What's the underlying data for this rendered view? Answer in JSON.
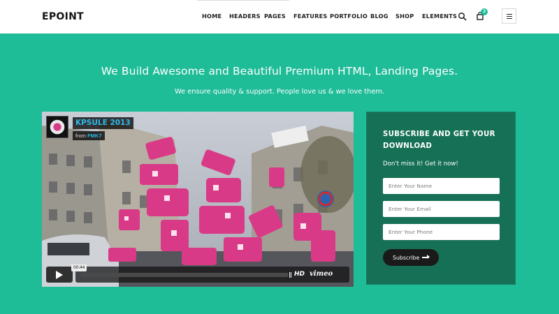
{
  "header": {
    "logo": "EPOINT",
    "nav": [
      {
        "label": "HOME"
      },
      {
        "label": "HEADERS"
      },
      {
        "label": "PAGES"
      },
      {
        "label": "FEATURES"
      },
      {
        "label": "PORTFOLIO"
      },
      {
        "label": "BLOG"
      },
      {
        "label": "SHOP"
      },
      {
        "label": "ELEMENTS"
      }
    ],
    "cart_count": "3",
    "icons": [
      "search-icon",
      "shopping-bag-icon",
      "hamburger-menu-icon"
    ]
  },
  "hero": {
    "title": "We Build Awesome and Beautiful Premium HTML, Landing Pages.",
    "subtitle": "We ensure quality & support. People love us & we love them."
  },
  "video": {
    "title": "KPSULE 2013",
    "from_prefix": "from",
    "author": "FMK7",
    "timecode": "00:44",
    "hd_label": "HD",
    "player_brand": "vimeo"
  },
  "subscribe": {
    "title": "SUBSCRIBE AND GET YOUR DOWNLOAD",
    "subtitle": "Don't miss it! Get it now!",
    "name_placeholder": "Enter Your Name",
    "email_placeholder": "Enter Your Email",
    "phone_placeholder": "Enter Your Phone",
    "button_label": "Subscribe"
  },
  "colors": {
    "accent": "#1fbc98",
    "card": "#167055",
    "button": "#1a1a1a",
    "video_link": "#2fb9e8"
  }
}
